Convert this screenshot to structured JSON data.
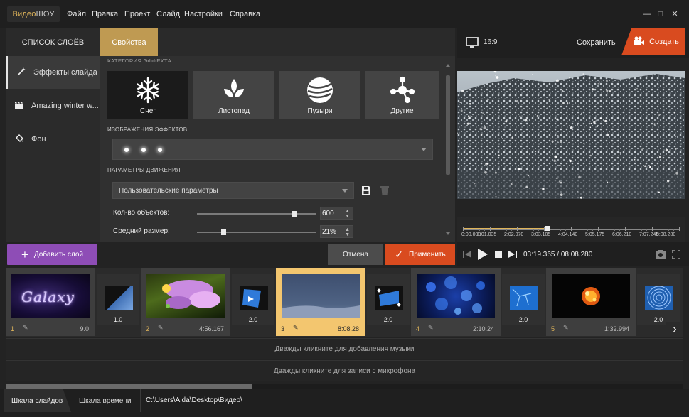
{
  "app": {
    "logo_part1": "Видео",
    "logo_part2": "ШОУ",
    "menu": [
      "Файл",
      "Правка",
      "Проект",
      "Слайд",
      "Настройки",
      "Справка"
    ]
  },
  "window_controls": {
    "minimize": "—",
    "maximize": "□",
    "close": "✕"
  },
  "left_tabs": {
    "layers": "СПИСОК СЛОЁВ",
    "properties": "Свойства"
  },
  "layers": [
    {
      "label": "Эффекты слайда",
      "icon": "magic-wand-icon"
    },
    {
      "label": "Amazing winter w...",
      "icon": "clapperboard-icon"
    },
    {
      "label": "Фон",
      "icon": "paint-bucket-icon"
    }
  ],
  "effects_section": {
    "header_cut": "КАТЕГОРИЯ ЭФФЕКТА",
    "tiles": [
      {
        "label": "Снег",
        "icon": "snowflake-icon"
      },
      {
        "label": "Листопад",
        "icon": "leaf-icon"
      },
      {
        "label": "Пузыри",
        "icon": "bubble-icon"
      },
      {
        "label": "Другие",
        "icon": "molecule-icon"
      }
    ],
    "images_label": "ИЗОБРАЖЕНИЯ ЭФФЕКТОВ:",
    "motion_label": "ПАРАМЕТРЫ ДВИЖЕНИЯ",
    "motion_preset": "Пользовательские параметры",
    "params": [
      {
        "label": "Кол-во объектов:",
        "value": "600",
        "fraction": 0.83
      },
      {
        "label": "Средний размер:",
        "value": "21%",
        "fraction": 0.21
      }
    ]
  },
  "buttons": {
    "add_layer": "Добавить слой",
    "add_layer_icon": "+",
    "cancel": "Отмена",
    "apply": "Применить",
    "apply_icon": "✓"
  },
  "preview": {
    "aspect": "16:9",
    "save": "Сохранить",
    "create": "Создать",
    "ticks": [
      "0:00.000",
      "1:01.035",
      "2:02.070",
      "3:03.105",
      "4:04.140",
      "5:05.175",
      "6:06.210",
      "7:07.245",
      "8:08.280"
    ],
    "position": 0.39,
    "timecode": "03:19.365 / 08:08.280"
  },
  "timeline": {
    "slides": [
      {
        "num": "1",
        "duration": "9.0"
      },
      {
        "num": "2",
        "duration": "4:56.167"
      },
      {
        "num": "3",
        "duration": "8:08.28"
      },
      {
        "num": "4",
        "duration": "2:10.24"
      },
      {
        "num": "5",
        "duration": "1:32.994"
      }
    ],
    "transitions": [
      "1.0",
      "2.0",
      "2.0",
      "2.0",
      "2.0"
    ],
    "slide1_text": "Galaxy",
    "music_hint": "Дважды кликните для добавления музыки",
    "mic_hint": "Дважды кликните для записи с микрофона"
  },
  "status": {
    "tab_slides": "Шкала слайдов",
    "tab_time": "Шкала времени",
    "path": "C:\\Users\\Aida\\Desktop\\Видео\\"
  },
  "colors": {
    "accent_gold": "#bf9a52",
    "accent_orange": "#d94b1f",
    "accent_purple": "#8e4db6"
  }
}
